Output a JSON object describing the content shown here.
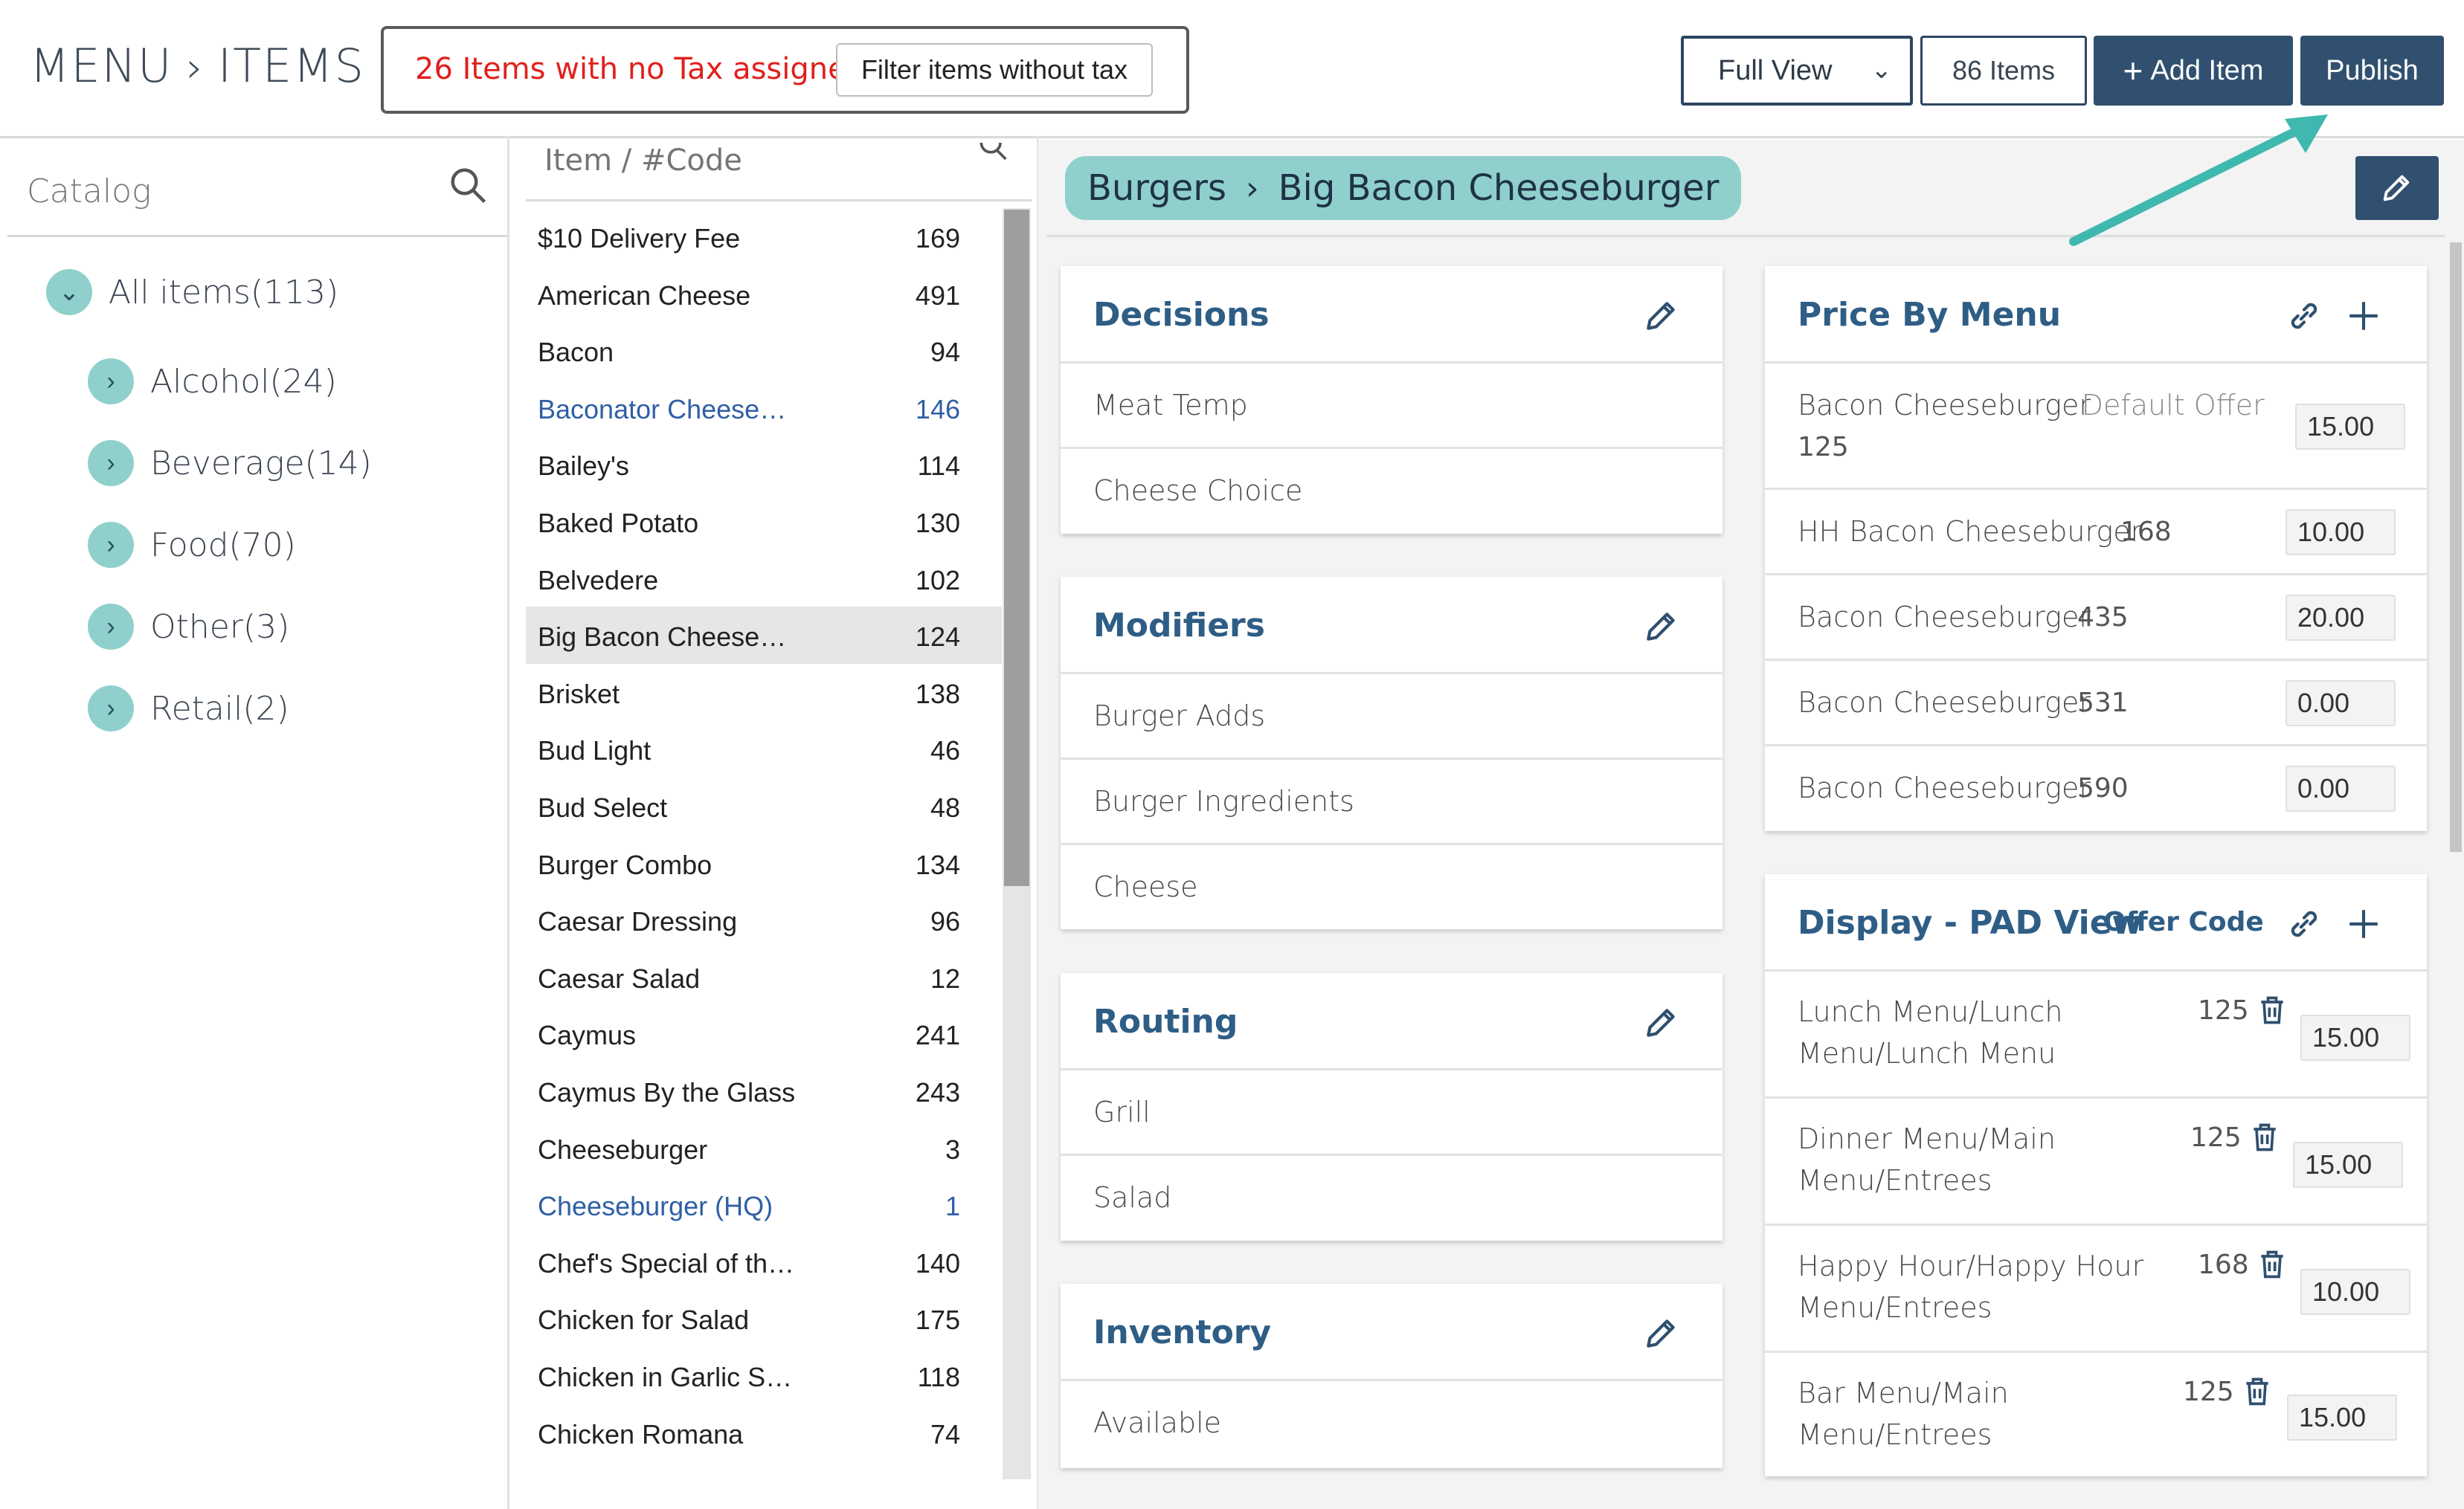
{
  "header": {
    "menu": "MENU",
    "items": "ITEMS",
    "alert_count": "26",
    "alert_text": "Items with no Tax assigned",
    "filter_button": "Filter items without tax",
    "view_select": "Full View",
    "items_count": "86 Items",
    "add_item": "Add Item",
    "publish": "Publish"
  },
  "catalog": {
    "label": "Catalog",
    "all_items": "All items(113)",
    "categories": [
      "Alcohol(24)",
      "Beverage(14)",
      "Food(70)",
      "Other(3)",
      "Retail(2)"
    ]
  },
  "item_list": {
    "search_placeholder": "Item / #Code",
    "rows": [
      {
        "name": "$10 Delivery Fee",
        "code": "169"
      },
      {
        "name": "American Cheese",
        "code": "491"
      },
      {
        "name": "Bacon",
        "code": "94"
      },
      {
        "name": "Baconator Cheese…",
        "code": "146"
      },
      {
        "name": "Bailey's",
        "code": "114"
      },
      {
        "name": "Baked Potato",
        "code": "130"
      },
      {
        "name": "Belvedere",
        "code": "102"
      },
      {
        "name": "Big Bacon Cheese…",
        "code": "124"
      },
      {
        "name": "Brisket",
        "code": "138"
      },
      {
        "name": "Bud Light",
        "code": "46"
      },
      {
        "name": "Bud Select",
        "code": "48"
      },
      {
        "name": "Burger Combo",
        "code": "134"
      },
      {
        "name": "Caesar Dressing",
        "code": "96"
      },
      {
        "name": "Caesar Salad",
        "code": "12"
      },
      {
        "name": "Caymus",
        "code": "241"
      },
      {
        "name": "Caymus By the Glass",
        "code": "243"
      },
      {
        "name": "Cheeseburger",
        "code": "3"
      },
      {
        "name": "Cheeseburger (HQ)",
        "code": "1"
      },
      {
        "name": "Chef's Special of th…",
        "code": "140"
      },
      {
        "name": "Chicken for Salad",
        "code": "175"
      },
      {
        "name": "Chicken in Garlic S…",
        "code": "118"
      },
      {
        "name": "Chicken Romana",
        "code": "74"
      }
    ]
  },
  "detail": {
    "breadcrumb_category": "Burgers",
    "breadcrumb_item": "Big Bacon Cheeseburger",
    "decisions": {
      "title": "Decisions",
      "rows": [
        "Meat Temp",
        "Cheese Choice"
      ]
    },
    "modifiers": {
      "title": "Modifiers",
      "rows": [
        "Burger Adds",
        "Burger Ingredients",
        "Cheese"
      ]
    },
    "routing": {
      "title": "Routing",
      "rows": [
        "Grill",
        "Salad"
      ]
    },
    "inventory": {
      "title": "Inventory",
      "rows": [
        "Available"
      ]
    },
    "price_by_menu": {
      "title": "Price By Menu",
      "first": {
        "name": "Bacon Cheeseburger",
        "tag": "- Default Offer",
        "code": "125",
        "price": "15.00"
      },
      "rows": [
        {
          "name": "HH Bacon Cheeseburger",
          "code": "168",
          "price": "10.00"
        },
        {
          "name": "Bacon Cheeseburger",
          "code": "435",
          "price": "20.00"
        },
        {
          "name": "Bacon Cheeseburger",
          "code": "531",
          "price": "0.00"
        },
        {
          "name": "Bacon Cheeseburger",
          "code": "590",
          "price": "0.00"
        }
      ]
    },
    "display_pad": {
      "title": "Display - PAD View",
      "offer_code": "Offer Code",
      "rows": [
        {
          "line1": "Lunch Menu/Lunch",
          "line2": "Menu/Lunch Menu",
          "code": "125",
          "price": "15.00"
        },
        {
          "line1": "Dinner Menu/Main",
          "line2": "Menu/Entrees",
          "code": "125",
          "price": "15.00"
        },
        {
          "line1": "Happy Hour/Happy Hour",
          "line2": "Menu/Entrees",
          "code": "168",
          "price": "10.00"
        },
        {
          "line1": "Bar Menu/Main",
          "line2": "Menu/Entrees",
          "code": "125",
          "price": "15.00"
        }
      ]
    }
  },
  "colors": {
    "accent": "#31506f",
    "teal": "#8fd0cc",
    "alert": "#e1201c",
    "link": "#2f5fa5",
    "arrow": "#3fb8b0"
  }
}
